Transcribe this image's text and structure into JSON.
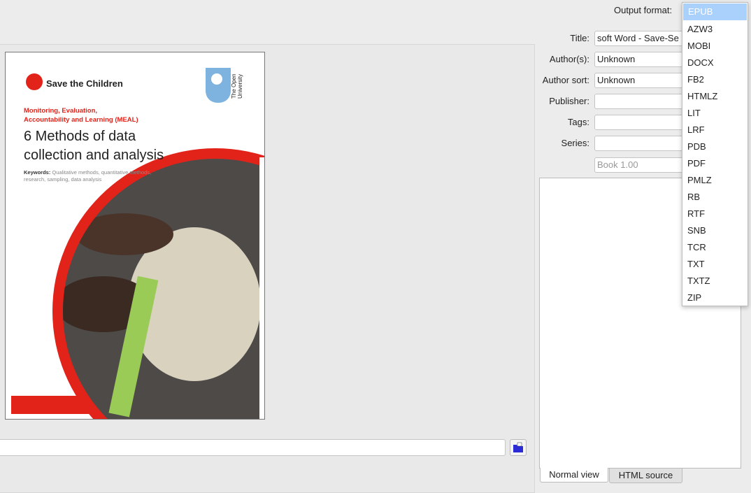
{
  "output_format": {
    "label": "Output format:",
    "selected": "EPUB",
    "options": [
      "EPUB",
      "AZW3",
      "MOBI",
      "DOCX",
      "FB2",
      "HTMLZ",
      "LIT",
      "LRF",
      "PDB",
      "PDF",
      "PMLZ",
      "RB",
      "RTF",
      "SNB",
      "TCR",
      "TXT",
      "TXTZ",
      "ZIP"
    ]
  },
  "metadata": {
    "title_label": "Title:",
    "title_value": "soft Word - Save-Se",
    "authors_label": "Author(s):",
    "authors_value": "Unknown",
    "author_sort_label": "Author sort:",
    "author_sort_value": "Unknown",
    "publisher_label": "Publisher:",
    "publisher_value": "",
    "tags_label": "Tags:",
    "tags_value": "",
    "series_label": "Series:",
    "series_value": "",
    "series_index_placeholder": "Book 1.00"
  },
  "cover": {
    "brand": "Save the Children",
    "university": "The Open University",
    "subtitle_line1": "Monitoring, Evaluation,",
    "subtitle_line2": "Accountability and Learning (MEAL)",
    "title_line1": "6 Methods of data",
    "title_line2": "collection and analysis",
    "keywords_label": "Keywords:",
    "keywords_line1": " Qualitative methods, quantitative methods,",
    "keywords_line2": "research, sampling, data analysis"
  },
  "comments_tabs": {
    "normal": "Normal view",
    "html": "HTML source"
  },
  "cover_path": {
    "value": ""
  },
  "colors": {
    "accent_red": "#e2231a",
    "selection": "#a9d1fb"
  }
}
